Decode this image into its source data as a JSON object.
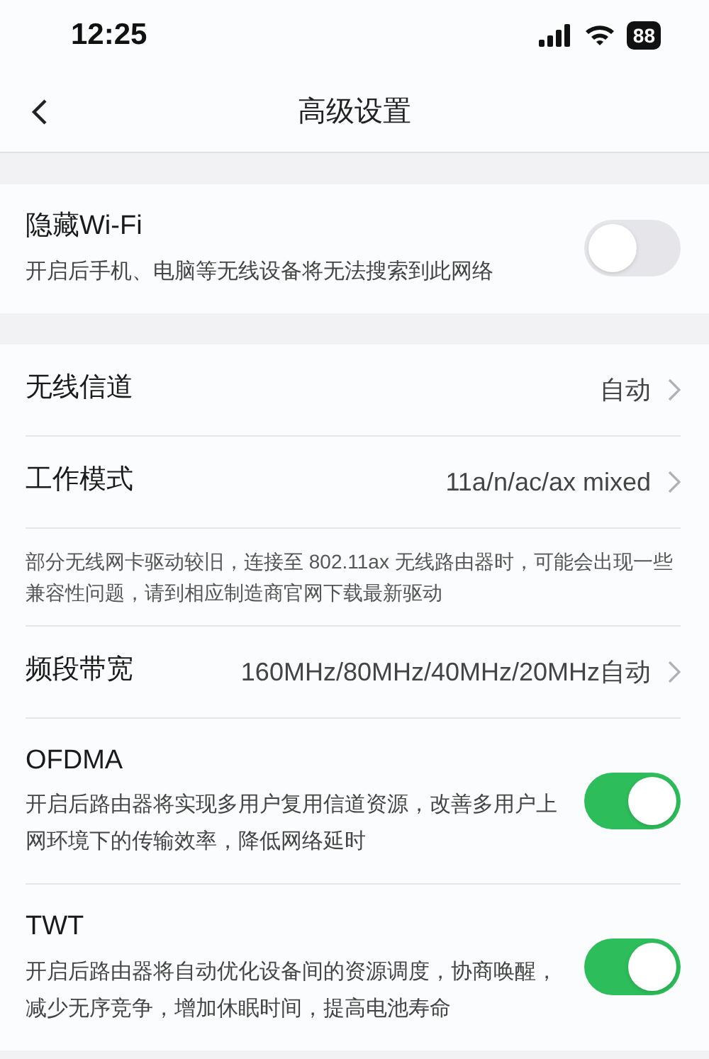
{
  "status_bar": {
    "time": "12:25",
    "battery": "88"
  },
  "nav": {
    "title": "高级设置"
  },
  "sections": [
    {
      "rows": [
        {
          "kind": "toggle",
          "title": "隐藏Wi-Fi",
          "description": "开启后手机、电脑等无线设备将无法搜索到此网络",
          "on": false
        }
      ]
    },
    {
      "rows": [
        {
          "kind": "value",
          "title": "无线信道",
          "value": "自动"
        },
        {
          "kind": "value",
          "title": "工作模式",
          "value": "11a/n/ac/ax mixed"
        },
        {
          "kind": "note",
          "text": "部分无线网卡驱动较旧，连接至 802.11ax 无线路由器时，可能会出现一些兼容性问题，请到相应制造商官网下载最新驱动"
        },
        {
          "kind": "value",
          "title": "频段带宽",
          "value": "160MHz/80MHz/40MHz/20MHz自动"
        },
        {
          "kind": "toggle",
          "title": "OFDMA",
          "description": "开启后路由器将实现多用户复用信道资源，改善多用户上网环境下的传输效率，降低网络延时",
          "on": true
        },
        {
          "kind": "toggle",
          "title": "TWT",
          "description": "开启后路由器将自动优化设备间的资源调度，协商唤醒，减少无序竞争，增加休眠时间，提高电池寿命",
          "on": true
        }
      ]
    }
  ]
}
